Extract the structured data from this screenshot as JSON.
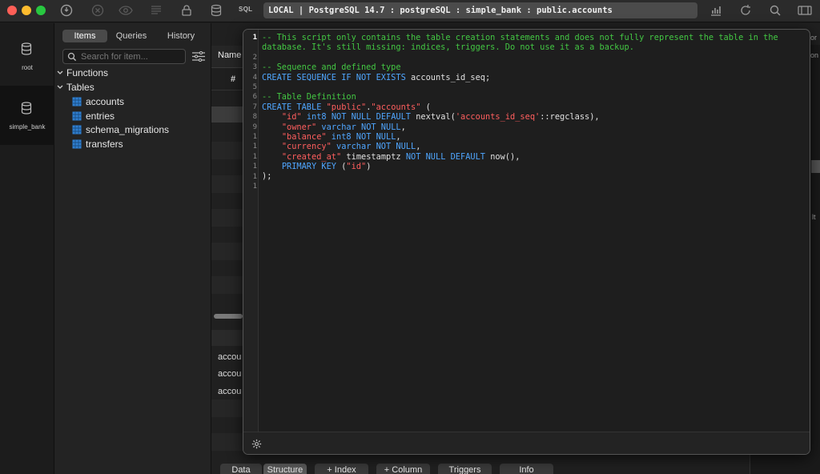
{
  "titlebar": {
    "sql_label": "SQL",
    "connection": "LOCAL | PostgreSQL 14.7 : postgreSQL : simple_bank : public.accounts",
    "icons": [
      "power-icon",
      "close-circle-icon",
      "eye-icon",
      "list-icon",
      "lock-icon",
      "database-icon",
      "chart-icon",
      "refresh-icon",
      "search-icon",
      "layout-icon"
    ]
  },
  "rail": {
    "items": [
      {
        "label": "root"
      },
      {
        "label": "simple_bank"
      }
    ]
  },
  "sidebar": {
    "tabs": [
      "Items",
      "Queries",
      "History"
    ],
    "search_placeholder": "Search for item...",
    "groups": [
      {
        "label": "Functions"
      },
      {
        "label": "Tables"
      }
    ],
    "tables": [
      "accounts",
      "entries",
      "schema_migrations",
      "transfers"
    ]
  },
  "grid": {
    "header_name": "Name",
    "header_hash": "#",
    "rows": [
      "accou",
      "accou",
      "accou"
    ],
    "right_fragments": [
      "or",
      "on",
      "lt"
    ]
  },
  "bottom_tabs": [
    "Data",
    "Structure",
    "+ Index",
    "+ Column",
    "Triggers",
    "Info"
  ],
  "definition": {
    "line_numbers": [
      "1",
      "2",
      "3",
      "4",
      "5",
      "6",
      "7",
      "8",
      "9",
      "1",
      "1",
      "1",
      "1",
      "1",
      "1"
    ],
    "lines": [
      [
        {
          "t": "c",
          "v": "-- This script only contains the table creation statements and does not fully represent the table in the"
        }
      ],
      [
        {
          "t": "c",
          "v": "database. It's still missing: indices, triggers. Do not use it as a backup."
        }
      ],
      [
        {
          "t": "pl",
          "v": ""
        }
      ],
      [
        {
          "t": "c",
          "v": "-- Sequence and defined type"
        }
      ],
      [
        {
          "t": "k",
          "v": "CREATE SEQUENCE IF NOT EXISTS "
        },
        {
          "t": "pl",
          "v": "accounts_id_seq;"
        }
      ],
      [
        {
          "t": "pl",
          "v": ""
        }
      ],
      [
        {
          "t": "c",
          "v": "-- Table Definition"
        }
      ],
      [
        {
          "t": "k",
          "v": "CREATE TABLE "
        },
        {
          "t": "s",
          "v": "\"public\""
        },
        {
          "t": "pl",
          "v": "."
        },
        {
          "t": "s",
          "v": "\"accounts\""
        },
        {
          "t": "pl",
          "v": " ("
        }
      ],
      [
        {
          "t": "pl",
          "v": "    "
        },
        {
          "t": "s",
          "v": "\"id\""
        },
        {
          "t": "k",
          "v": " int8 NOT NULL DEFAULT "
        },
        {
          "t": "pl",
          "v": "nextval("
        },
        {
          "t": "s",
          "v": "'accounts_id_seq'"
        },
        {
          "t": "pl",
          "v": "::regclass),"
        }
      ],
      [
        {
          "t": "pl",
          "v": "    "
        },
        {
          "t": "s",
          "v": "\"owner\""
        },
        {
          "t": "k",
          "v": " varchar NOT NULL"
        },
        {
          "t": "pl",
          "v": ","
        }
      ],
      [
        {
          "t": "pl",
          "v": "    "
        },
        {
          "t": "s",
          "v": "\"balance\""
        },
        {
          "t": "k",
          "v": " int8 NOT NULL"
        },
        {
          "t": "pl",
          "v": ","
        }
      ],
      [
        {
          "t": "pl",
          "v": "    "
        },
        {
          "t": "s",
          "v": "\"currency\""
        },
        {
          "t": "k",
          "v": " varchar NOT NULL"
        },
        {
          "t": "pl",
          "v": ","
        }
      ],
      [
        {
          "t": "pl",
          "v": "    "
        },
        {
          "t": "s",
          "v": "\"created_at\""
        },
        {
          "t": "pl",
          "v": " timestamptz "
        },
        {
          "t": "k",
          "v": "NOT NULL DEFAULT "
        },
        {
          "t": "pl",
          "v": "now(),"
        }
      ],
      [
        {
          "t": "pl",
          "v": "    "
        },
        {
          "t": "k",
          "v": "PRIMARY KEY "
        },
        {
          "t": "pl",
          "v": "("
        },
        {
          "t": "s",
          "v": "\"id\""
        },
        {
          "t": "pl",
          "v": ")"
        }
      ],
      [
        {
          "t": "pl",
          "v": ");"
        }
      ]
    ]
  },
  "colors": {
    "comment": "#43c743",
    "keyword": "#4fa6ff",
    "string": "#ff5e5e",
    "plain": "#e0e0e0"
  }
}
